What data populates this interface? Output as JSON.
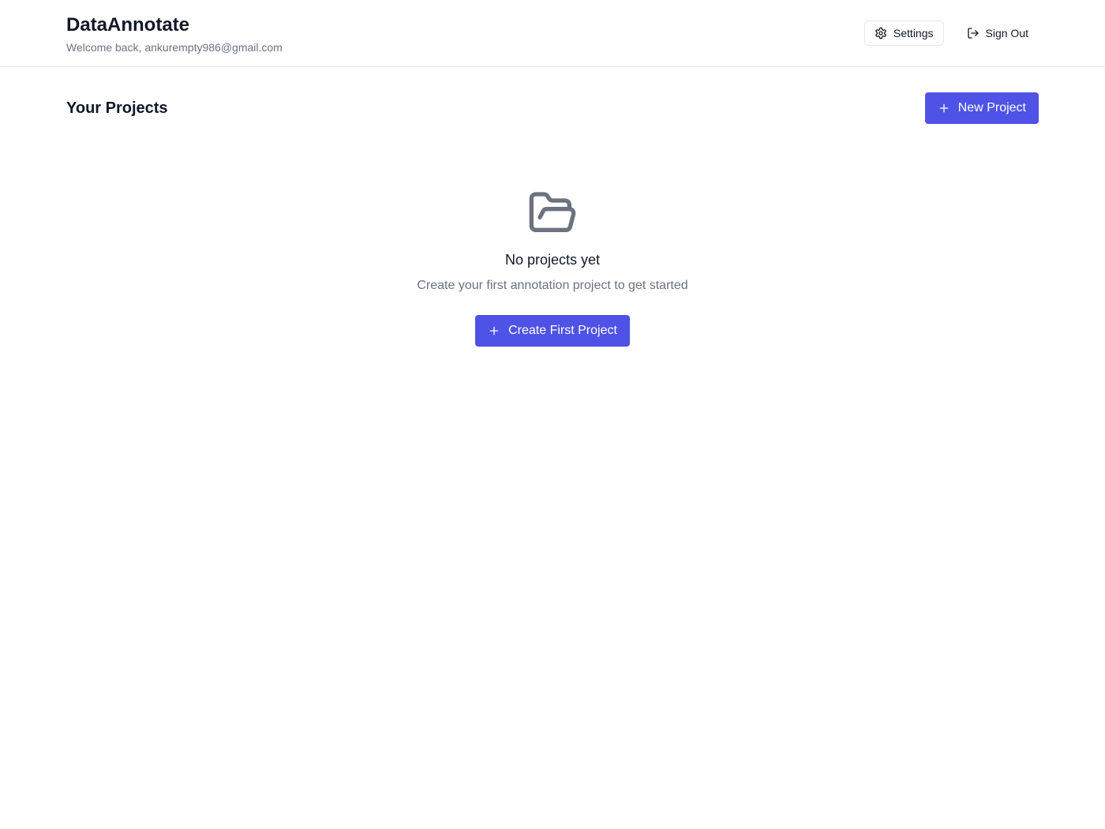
{
  "header": {
    "title": "DataAnnotate",
    "subtitle": "Welcome back, ankurempty986@gmail.com",
    "settings_label": "Settings",
    "signout_label": "Sign Out"
  },
  "projects": {
    "title": "Your Projects",
    "new_project_label": "New Project"
  },
  "empty_state": {
    "title": "No projects yet",
    "description": "Create your first annotation project to get started",
    "cta_label": "Create First Project"
  },
  "icons": {
    "settings": "gear-icon",
    "signout": "log-out-icon",
    "plus": "plus-icon",
    "empty": "folder-open-icon"
  },
  "colors": {
    "primary": "#4f52e6",
    "text": "#111827",
    "muted": "#6b7280",
    "border": "#e5e7eb",
    "icon_gray": "#6b7280"
  }
}
